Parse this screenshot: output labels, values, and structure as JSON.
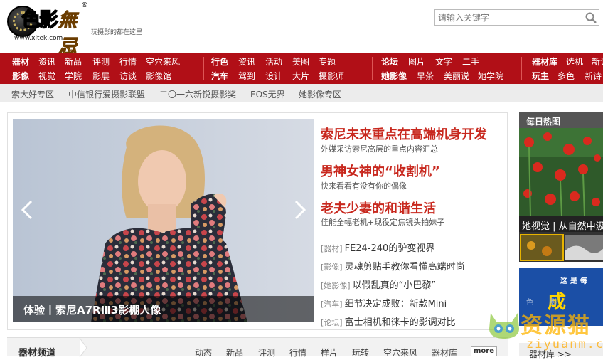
{
  "header": {
    "logo_text_1": "色影",
    "logo_text_2": "無忌",
    "logo_reg": "®",
    "logo_url": "www.xitek.com",
    "slogan": "玩摄影的都在这里",
    "search_placeholder": "请输入关键字"
  },
  "rednav": {
    "groups": [
      {
        "row1": [
          "器材",
          "资讯",
          "新品",
          "评测",
          "行情",
          "空穴来风"
        ],
        "row2": [
          "影像",
          "视觉",
          "学院",
          "影展",
          "访谈",
          "影像馆"
        ]
      },
      {
        "row1": [
          "行色",
          "资讯",
          "活动",
          "美图",
          "专题"
        ],
        "row2": [
          "汽车",
          "驾到",
          "设计",
          "大片",
          "摄影师"
        ]
      },
      {
        "row1": [
          "论坛",
          "图片",
          "文字",
          "二手"
        ],
        "row2": [
          "她影像",
          "早茶",
          "美丽说",
          "她学院"
        ]
      },
      {
        "row1": [
          "器材库",
          "选机",
          "新诗"
        ],
        "row2": [
          "玩主",
          "多色",
          "新诗"
        ]
      }
    ]
  },
  "subnav": [
    "索大好专区",
    "中信银行爱摄影联盟",
    "二〇一六新锐摄影奖",
    "EOS无界",
    "她影像专区"
  ],
  "slider": {
    "caption": "体验丨索尼A7RⅢ3影棚人像",
    "headlines": [
      {
        "title": "索尼未来重点在高端机身开发",
        "sub": "外媒采访索尼高层的重点内容汇总"
      },
      {
        "title": "男神女神的“收割机”",
        "sub": "快来看看有没有你的偶像"
      },
      {
        "title": "老夫少妻的和谐生活",
        "sub": "佳能全幅老机+现役定焦镜头拍妹子"
      }
    ],
    "news": [
      {
        "tag": "[器材]",
        "text": "FE24-240的驴变视界"
      },
      {
        "tag": "[影像]",
        "text": "灵魂剪贴手教你看懂高端时尚"
      },
      {
        "tag": "[她影像]",
        "text": "以假乱真的“小巴黎”"
      },
      {
        "tag": "[汽车]",
        "text": "细节决定成败：新款Mini"
      },
      {
        "tag": "[论坛]",
        "text": "富士相机和徕卡的影调对比"
      }
    ]
  },
  "sidebar": {
    "hot_title": "每日热图",
    "hot_caption": "她视觉 | 从自然中汲",
    "banner_line1": "这是每",
    "banner_line2": "成",
    "banner_sub": "色 影"
  },
  "channel": {
    "title": "器材频道",
    "items": [
      "动态",
      "新品",
      "评测",
      "行情",
      "样片",
      "玩转",
      "空穴来风",
      "器材库"
    ],
    "more": "more",
    "lib": "器材库 >>"
  },
  "watermark": {
    "text": "资源猫",
    "url": "ziyuanm.com"
  }
}
